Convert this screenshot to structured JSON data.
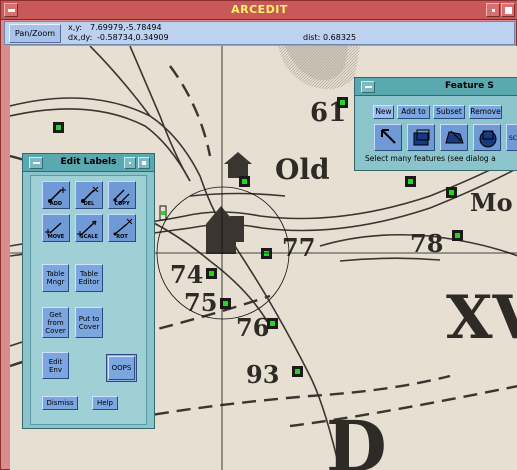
{
  "window": {
    "title": "ARCEDIT"
  },
  "info": {
    "panzoom_label": "Pan/Zoom",
    "xy_label": "x,y:",
    "xy_value": "7.69979,-5.78494",
    "dxdy_label": "dx,dy:",
    "dxdy_value": "-0.58734,0.34909",
    "dist_label": "dist:",
    "dist_value": "0.68325"
  },
  "map": {
    "labels": [
      "61",
      "Old",
      "Mo",
      "77",
      "78",
      "74",
      "75",
      "76",
      "93",
      "XV",
      "D"
    ]
  },
  "edit_labels": {
    "title": "Edit Labels",
    "tools": [
      {
        "label": "ADD",
        "icon": "add-label-icon"
      },
      {
        "label": "DEL",
        "icon": "delete-label-icon"
      },
      {
        "label": "COPY",
        "icon": "copy-label-icon"
      },
      {
        "label": "MOVE",
        "icon": "move-label-icon"
      },
      {
        "label": "SCALE",
        "icon": "scale-label-icon"
      },
      {
        "label": "ROT",
        "icon": "rotate-label-icon"
      }
    ],
    "table_mngr": "Table Mngr",
    "table_editor": "Table Editor",
    "get_from_cover": "Get from Cover",
    "put_to_cover": "Put to Cover",
    "edit_env": "Edit Env",
    "oops": "OOPS",
    "dismiss": "Dismiss",
    "help": "Help"
  },
  "feature_selection": {
    "title": "Feature S",
    "buttons": [
      "New",
      "Add to",
      "Subset",
      "Remove"
    ],
    "active_button": "New",
    "status": "Select many features (see dialog a"
  },
  "colors": {
    "window_frame": "#d98c8c",
    "title_text": "#fff26a",
    "infobar_bg": "#bcd2f0",
    "dialog_bg": "#8cc4cc",
    "button_bg": "#7ca6e0",
    "label_marker": "#1fd81f"
  }
}
